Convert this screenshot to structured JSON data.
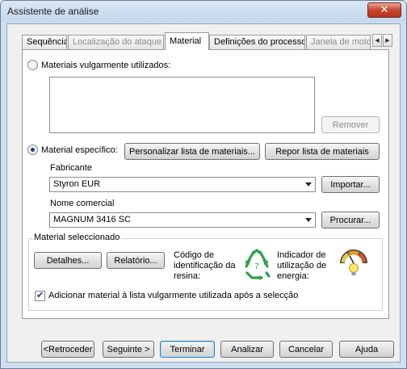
{
  "window": {
    "title": "Assistente de análise",
    "close_glyph": "✕"
  },
  "tabs": [
    {
      "label": "Sequência",
      "state": "normal"
    },
    {
      "label": "Localização do ataque",
      "state": "disabled"
    },
    {
      "label": "Material",
      "state": "active"
    },
    {
      "label": "Definições do processo",
      "state": "normal"
    },
    {
      "label": "Janela de mold",
      "state": "disabled"
    }
  ],
  "tab_scroll": {
    "left": "◀",
    "right": "▶"
  },
  "common": {
    "radio_label": "Materiais vulgarmente utilizados:",
    "remove_button": "Remover"
  },
  "specific": {
    "radio_label": "Material específico:",
    "customize_button": "Personalizar lista de materiais...",
    "reset_button": "Repor lista de materiais",
    "manufacturer_label": "Fabricante",
    "manufacturer_value": "Styron EUR",
    "import_button": "Importar...",
    "trade_name_label": "Nome comercial",
    "trade_name_value": "MAGNUM 3416 SC",
    "search_button": "Procurar..."
  },
  "selected_material": {
    "legend": "Material seleccionado",
    "details_button": "Detalhes...",
    "report_button": "Relatório...",
    "resin_code_label": [
      "Código de",
      "identificação da",
      "resina:"
    ],
    "resin_code_number": "7",
    "energy_label": [
      "Indicador de",
      "utilização de",
      "energia:"
    ],
    "add_to_common_label": "Adicionar material à lista vulgarmente utilizada após a selecção",
    "add_to_common_checked": true
  },
  "footer": {
    "back_button": "<Retroceder",
    "next_button": "Seguinte >",
    "finish_button": "Terminar",
    "analyze_button": "Analizar",
    "cancel_button": "Cancelar",
    "help_button": "Ajuda"
  },
  "colors": {
    "recycle_green": "#2fa24a",
    "gauge_orange": "#e39a2c",
    "bulb_yellow": "#ffe66b"
  },
  "icons": {
    "recycling": "recycling-icon",
    "energy": "energy-gauge-icon"
  }
}
